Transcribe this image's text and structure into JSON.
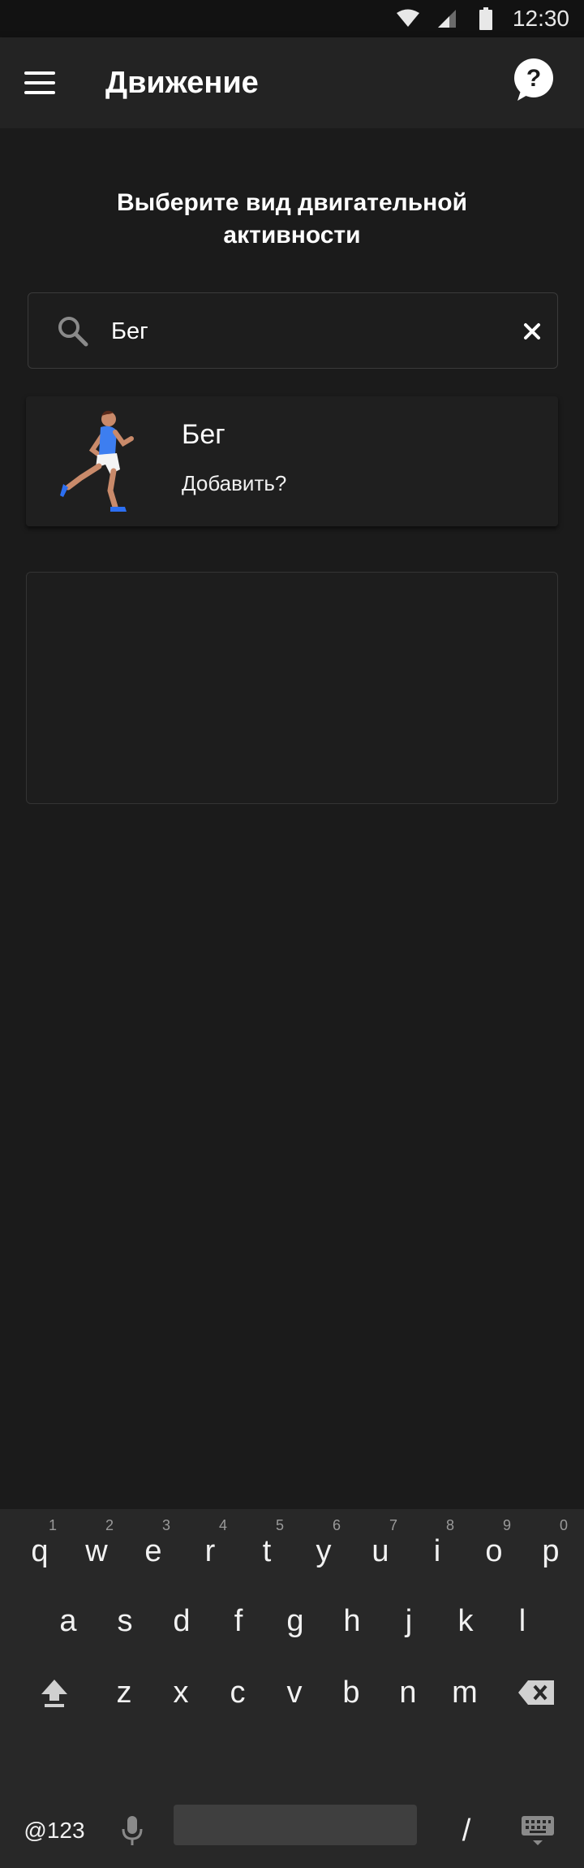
{
  "status_bar": {
    "time": "12:30"
  },
  "app_bar": {
    "title": "Движение"
  },
  "main": {
    "heading": "Выберите вид двигательной активности",
    "search": {
      "value": "Бег",
      "placeholder": ""
    },
    "result": {
      "title": "Бег",
      "subtitle": "Добавить?"
    }
  },
  "keyboard": {
    "row1": [
      {
        "key": "q",
        "hint": "1"
      },
      {
        "key": "w",
        "hint": "2"
      },
      {
        "key": "e",
        "hint": "3"
      },
      {
        "key": "r",
        "hint": "4"
      },
      {
        "key": "t",
        "hint": "5"
      },
      {
        "key": "y",
        "hint": "6"
      },
      {
        "key": "u",
        "hint": "7"
      },
      {
        "key": "i",
        "hint": "8"
      },
      {
        "key": "o",
        "hint": "9"
      },
      {
        "key": "p",
        "hint": "0"
      }
    ],
    "row2": [
      "a",
      "s",
      "d",
      "f",
      "g",
      "h",
      "j",
      "k",
      "l"
    ],
    "row3": [
      "z",
      "x",
      "c",
      "v",
      "b",
      "n",
      "m"
    ],
    "symbols_label": "@123",
    "slash_label": "/"
  },
  "colors": {
    "background": "#1b1b1b",
    "app_bar": "#232323",
    "keyboard": "#282828",
    "runner_shirt": "#3d7ef0",
    "runner_shoes": "#2c6ff2"
  }
}
